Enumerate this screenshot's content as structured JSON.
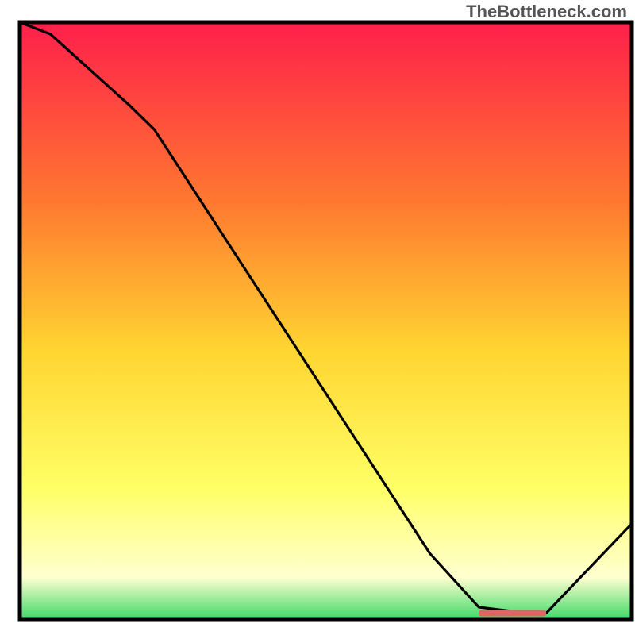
{
  "watermark": "TheBottleneck.com",
  "colors": {
    "gradient_top": "#ff1f4b",
    "gradient_mid1": "#ff7830",
    "gradient_mid2": "#ffd531",
    "gradient_mid3": "#ffff66",
    "gradient_mid4": "#ffffd0",
    "gradient_bottom": "#3fd968",
    "line": "#000000",
    "marker": "#e06666",
    "frame": "#000000"
  },
  "chart_data": {
    "type": "line",
    "title": "",
    "xlabel": "",
    "ylabel": "",
    "xlim": [
      0,
      100
    ],
    "ylim": [
      0,
      100
    ],
    "legend": false,
    "grid": false,
    "series": [
      {
        "name": "curve",
        "x": [
          0,
          5,
          18,
          22,
          67,
          75,
          83,
          86,
          100
        ],
        "values": [
          100,
          98,
          86,
          82,
          11,
          2,
          1,
          1,
          16
        ]
      }
    ],
    "marker": {
      "name": "highlight-segment",
      "x_start": 75,
      "x_end": 86,
      "y": 1
    }
  }
}
